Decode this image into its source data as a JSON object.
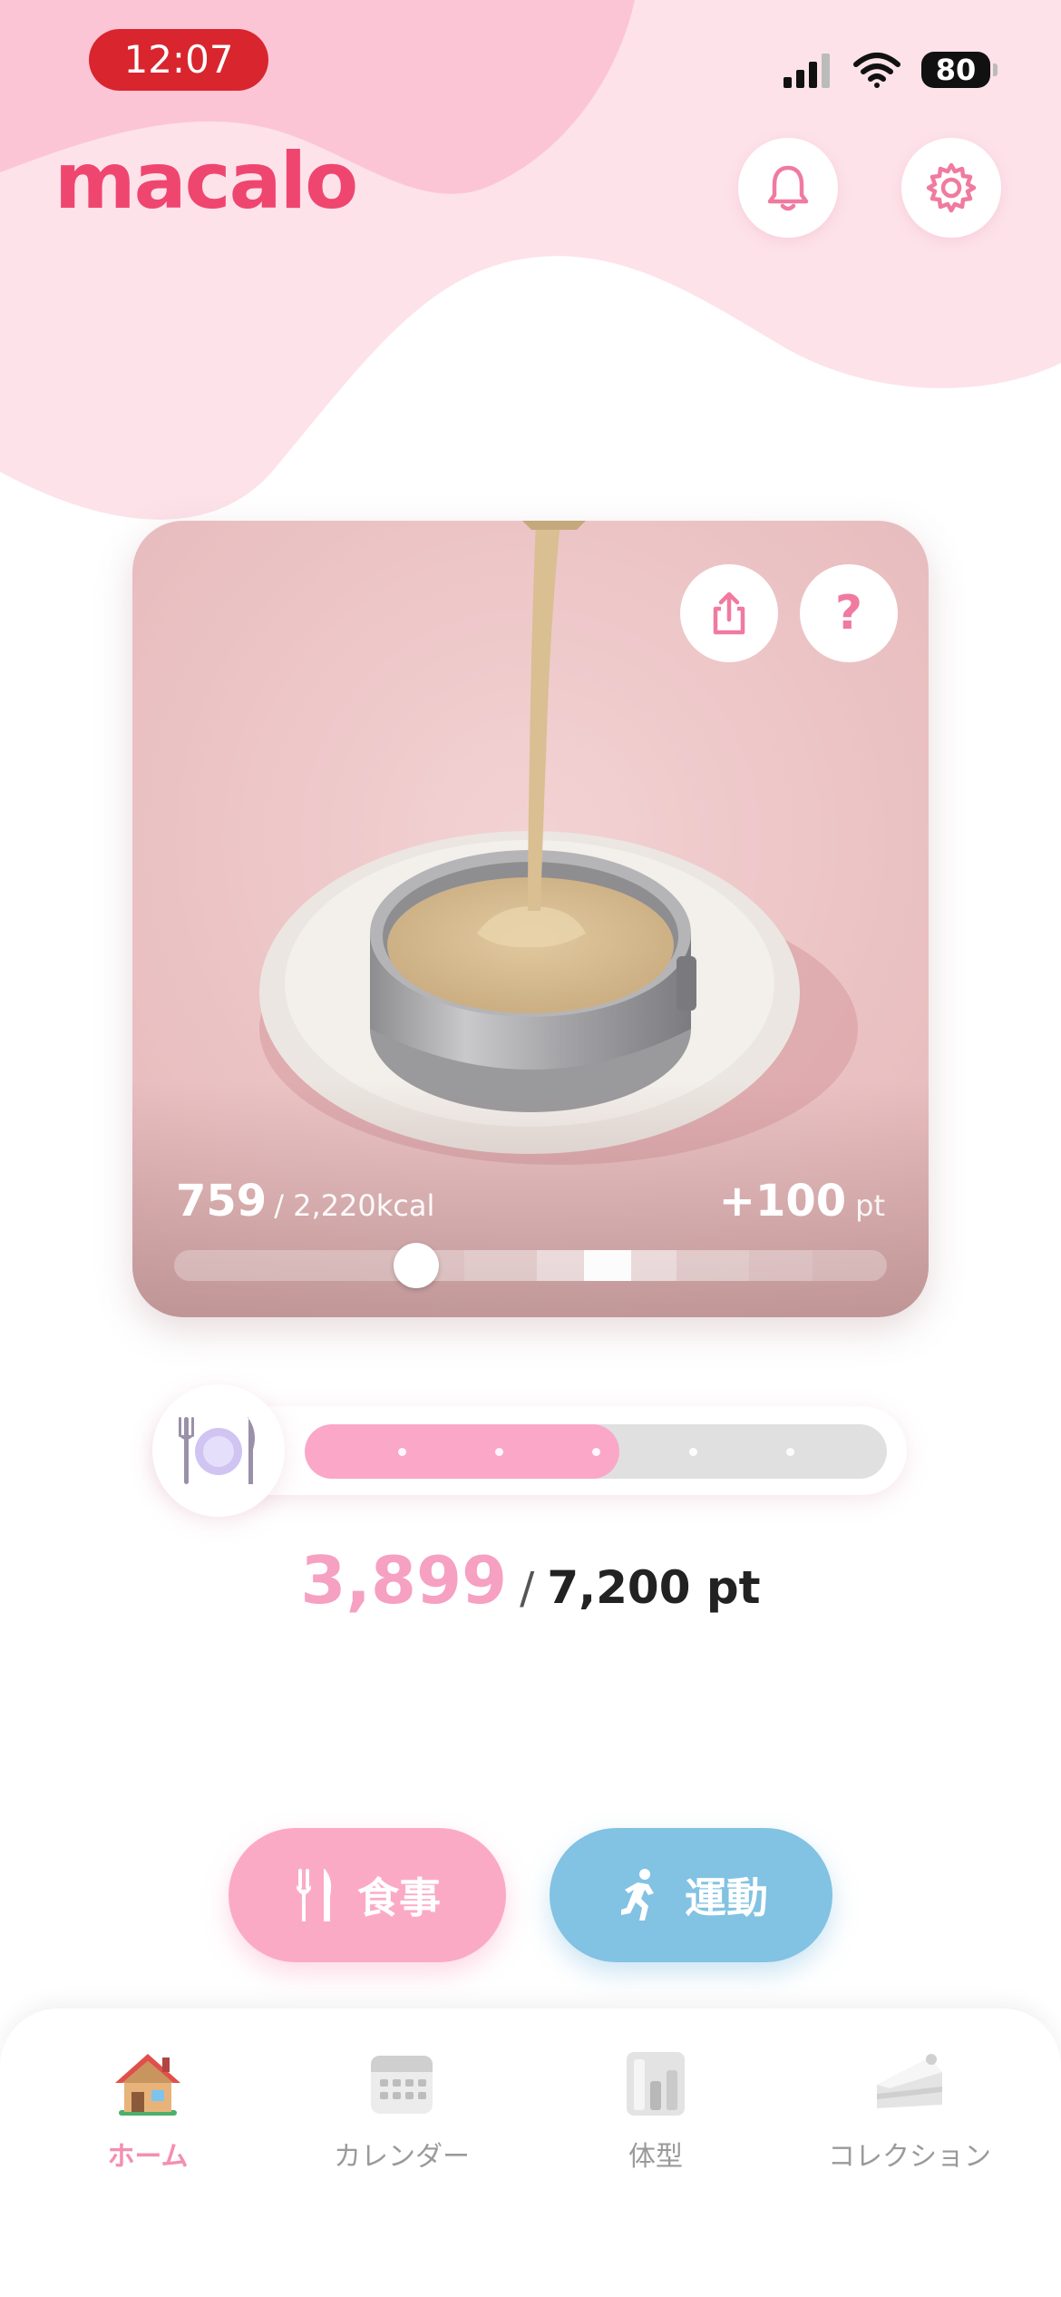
{
  "status_bar": {
    "time": "12:07",
    "battery": "80"
  },
  "header": {
    "logo": "macalo"
  },
  "meal_card": {
    "kcal_current": "759",
    "kcal_goal": "/ 2,220kcal",
    "points_gain": "+100",
    "points_unit": "pt",
    "kcal_progress": 0.34
  },
  "points": {
    "current": "3,899",
    "separator": "/",
    "goal": "7,200 pt",
    "progress": 0.54
  },
  "actions": {
    "meal_label": "食事",
    "exercise_label": "運動"
  },
  "nav": {
    "items": [
      {
        "label": "ホーム",
        "icon": "house-icon",
        "active": true
      },
      {
        "label": "カレンダー",
        "icon": "calendar-icon",
        "active": false
      },
      {
        "label": "体型",
        "icon": "body-chart-icon",
        "active": false
      },
      {
        "label": "コレクション",
        "icon": "cake-slice-icon",
        "active": false
      }
    ]
  },
  "colors": {
    "accent_pink": "#ef4670",
    "light_pink": "#fbaac6",
    "exercise_blue": "#82c2e2",
    "status_red": "#d9252e"
  }
}
